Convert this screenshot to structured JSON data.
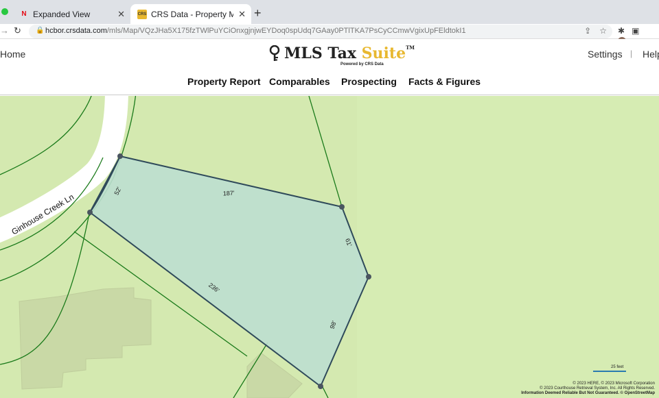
{
  "browser": {
    "tabs": [
      {
        "favicon": "N",
        "title": "Expanded View",
        "close": "✕"
      },
      {
        "favicon": "CRS",
        "title": "CRS Data - Property Map for U",
        "close": "✕"
      }
    ],
    "new_tab": "+",
    "url_domain": "hcbor.crsdata.com",
    "url_path": "/mls/Map/VQzJHa5X175fzTWlPuYCiOnxgjnjwEYDoq0spUdq7GAay0PTlTKA7PsCyCCmwVgixUpFEldtokI1"
  },
  "header": {
    "home": "Home",
    "logo_main": "MLS Tax ",
    "logo_accent": "Suite",
    "logo_tm": "TM",
    "logo_sub": "Powered by CRS Data",
    "settings": "Settings",
    "separator": "|",
    "help": "Help",
    "nav": [
      "Property Report",
      "Comparables",
      "Prospecting",
      "Facts & Figures"
    ]
  },
  "map": {
    "street_name": "Ginhouse Creek Ln",
    "dimensions": {
      "top": "187'",
      "left_short": "52'",
      "right_upper": "61'",
      "right_lower": "98'",
      "bottom": "236'"
    },
    "scale_label": "25 feet",
    "attribution": [
      "© 2023 HERE, © 2023 Microsoft Corporation",
      "© 2023 Courthouse Retrieval System, Inc. All Rights Reserved.",
      "Information Deemed Reliable But Not Guaranteed. © OpenStreetMap"
    ],
    "colors": {
      "land": "#d4e9b0",
      "parcel_fill": "#bddfd0",
      "parcel_stroke": "#2f4a5a",
      "lot_lines": "#1a7a1a",
      "road": "#ffffff"
    }
  }
}
